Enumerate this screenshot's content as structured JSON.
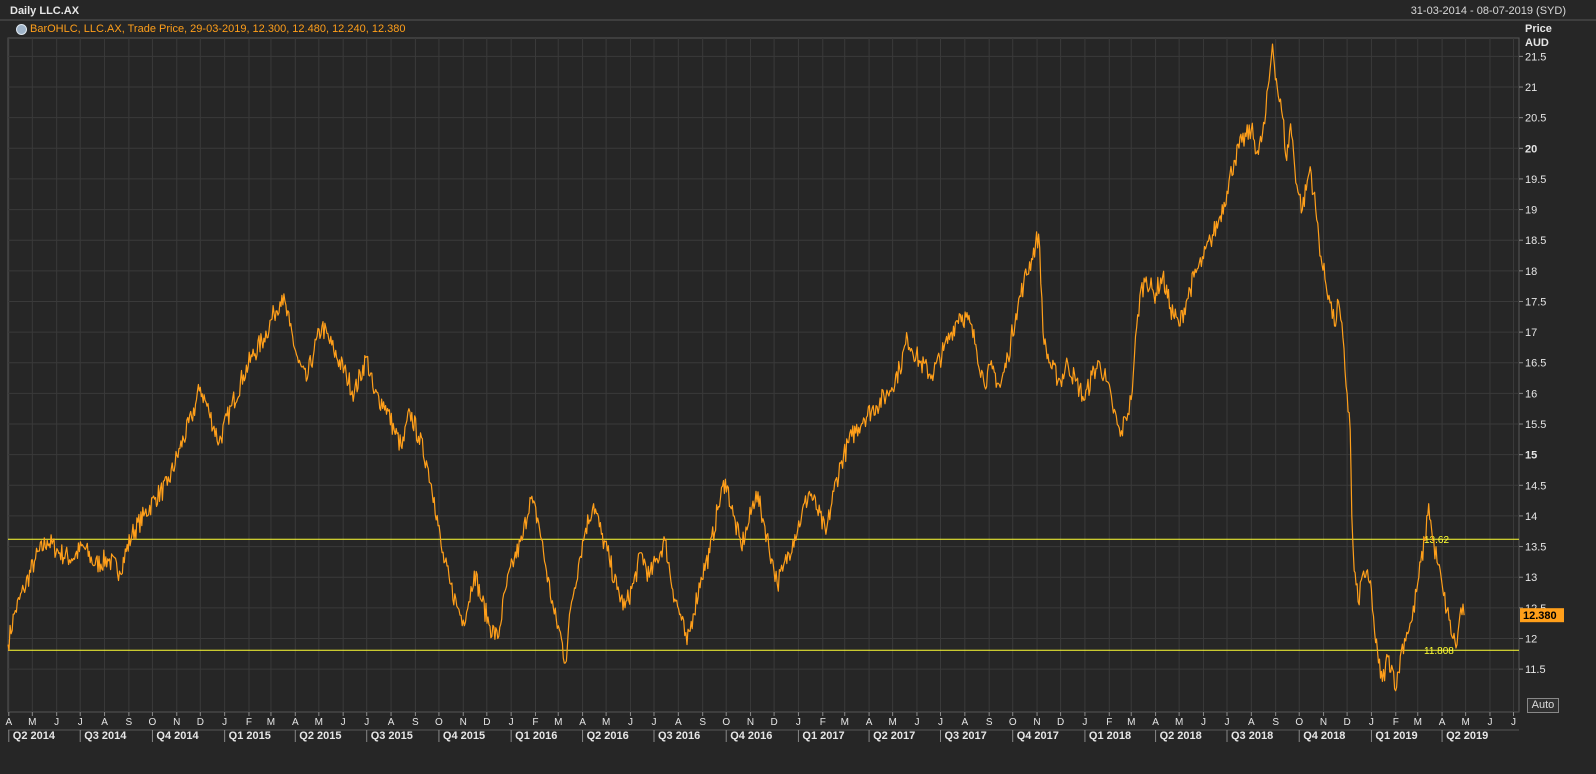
{
  "header": {
    "title": "Daily LLC.AX",
    "date_range": "31-03-2014 - 08-07-2019 (SYD)",
    "legend": "BarOHLC, LLC.AX, Trade Price, 29-03-2019, 12.300, 12.480, 12.240, 12.380",
    "y_axis_title": [
      "Price",
      "AUD"
    ],
    "auto_button": "Auto"
  },
  "colors": {
    "background": "#262626",
    "grid": "#3a3a3a",
    "price_line": "#ff9f1a",
    "level_line": "#ffff33",
    "axis_text": "#e6e6e6"
  },
  "chart_data": {
    "type": "line",
    "title": "Daily LLC.AX",
    "ylabel": "Price AUD",
    "ylim": [
      10.8,
      21.8
    ],
    "grid": true,
    "y_ticks": [
      11.5,
      12,
      12.5,
      13,
      13.5,
      14,
      14.5,
      15,
      15.5,
      16,
      16.5,
      17,
      17.5,
      18,
      18.5,
      19,
      19.5,
      20,
      20.5,
      21,
      21.5
    ],
    "bold_y_ticks": [
      15,
      20
    ],
    "month_labels": [
      "A",
      "M",
      "J",
      "J",
      "A",
      "S",
      "O",
      "N",
      "D",
      "J",
      "F",
      "M",
      "A",
      "M",
      "J",
      "J",
      "A",
      "S",
      "O",
      "N",
      "D",
      "J",
      "F",
      "M",
      "A",
      "M",
      "J",
      "J",
      "A",
      "S",
      "O",
      "N",
      "D",
      "J",
      "F",
      "M",
      "A",
      "M",
      "J",
      "J",
      "A",
      "S",
      "O",
      "N",
      "D",
      "J",
      "F",
      "M",
      "A",
      "M",
      "J",
      "J",
      "A",
      "S",
      "O",
      "N",
      "D",
      "J",
      "F",
      "M",
      "A",
      "M",
      "J",
      "J"
    ],
    "quarter_labels": [
      "Q2 2014",
      "Q3 2014",
      "Q4 2014",
      "Q1 2015",
      "Q2 2015",
      "Q3 2015",
      "Q4 2015",
      "Q1 2016",
      "Q2 2016",
      "Q3 2016",
      "Q4 2016",
      "Q1 2017",
      "Q2 2017",
      "Q3 2017",
      "Q4 2017",
      "Q1 2018",
      "Q2 2018",
      "Q3 2018",
      "Q4 2018",
      "Q1 2019",
      "Q2 2019"
    ],
    "horizontal_levels": [
      {
        "value": 13.62,
        "label": "13.62"
      },
      {
        "value": 11.808,
        "label": "11.808"
      }
    ],
    "last_price": {
      "value": 12.38,
      "label": "12.380"
    },
    "series": [
      {
        "name": "LLC.AX",
        "points": [
          [
            "2014-03-31",
            11.9
          ],
          [
            "2014-04-08",
            12.4
          ],
          [
            "2014-04-20",
            12.8
          ],
          [
            "2014-05-05",
            13.3
          ],
          [
            "2014-05-20",
            13.6
          ],
          [
            "2014-06-05",
            13.4
          ],
          [
            "2014-06-20",
            13.3
          ],
          [
            "2014-07-05",
            13.5
          ],
          [
            "2014-07-20",
            13.2
          ],
          [
            "2014-08-05",
            13.3
          ],
          [
            "2014-08-20",
            13.1
          ],
          [
            "2014-09-05",
            13.7
          ],
          [
            "2014-09-20",
            14.0
          ],
          [
            "2014-10-05",
            14.3
          ],
          [
            "2014-10-20",
            14.5
          ],
          [
            "2014-11-05",
            15.1
          ],
          [
            "2014-11-20",
            15.6
          ],
          [
            "2014-12-01",
            16.1
          ],
          [
            "2014-12-12",
            15.7
          ],
          [
            "2014-12-25",
            15.2
          ],
          [
            "2015-01-10",
            15.8
          ],
          [
            "2015-01-25",
            16.3
          ],
          [
            "2015-02-05",
            16.6
          ],
          [
            "2015-02-20",
            16.9
          ],
          [
            "2015-03-05",
            17.3
          ],
          [
            "2015-03-15",
            17.6
          ],
          [
            "2015-03-25",
            17.1
          ],
          [
            "2015-04-05",
            16.5
          ],
          [
            "2015-04-15",
            16.2
          ],
          [
            "2015-04-25",
            16.7
          ],
          [
            "2015-05-05",
            17.1
          ],
          [
            "2015-05-20",
            16.7
          ],
          [
            "2015-06-05",
            16.3
          ],
          [
            "2015-06-15",
            16.0
          ],
          [
            "2015-07-01",
            16.6
          ],
          [
            "2015-07-10",
            16.0
          ],
          [
            "2015-07-25",
            15.8
          ],
          [
            "2015-08-05",
            15.4
          ],
          [
            "2015-08-15",
            15.1
          ],
          [
            "2015-08-25",
            15.7
          ],
          [
            "2015-09-05",
            15.3
          ],
          [
            "2015-09-15",
            14.9
          ],
          [
            "2015-09-25",
            14.3
          ],
          [
            "2015-10-05",
            13.4
          ],
          [
            "2015-10-15",
            12.9
          ],
          [
            "2015-10-25",
            12.5
          ],
          [
            "2015-11-01",
            12.3
          ],
          [
            "2015-11-08",
            12.6
          ],
          [
            "2015-11-15",
            13.1
          ],
          [
            "2015-11-25",
            12.6
          ],
          [
            "2015-12-05",
            12.2
          ],
          [
            "2015-12-15",
            12.0
          ],
          [
            "2015-12-25",
            12.8
          ],
          [
            "2016-01-05",
            13.3
          ],
          [
            "2016-01-15",
            13.6
          ],
          [
            "2016-01-25",
            14.3
          ],
          [
            "2016-02-05",
            13.9
          ],
          [
            "2016-02-15",
            13.1
          ],
          [
            "2016-02-25",
            12.4
          ],
          [
            "2016-03-05",
            12.0
          ],
          [
            "2016-03-10",
            11.6
          ],
          [
            "2016-03-18",
            12.6
          ],
          [
            "2016-03-28",
            13.3
          ],
          [
            "2016-04-05",
            13.8
          ],
          [
            "2016-04-15",
            14.2
          ],
          [
            "2016-04-25",
            13.7
          ],
          [
            "2016-05-05",
            13.3
          ],
          [
            "2016-05-15",
            12.8
          ],
          [
            "2016-05-25",
            12.5
          ],
          [
            "2016-06-05",
            12.9
          ],
          [
            "2016-06-15",
            13.4
          ],
          [
            "2016-06-25",
            13.0
          ],
          [
            "2016-07-05",
            13.3
          ],
          [
            "2016-07-15",
            13.6
          ],
          [
            "2016-07-25",
            12.8
          ],
          [
            "2016-08-05",
            12.3
          ],
          [
            "2016-08-12",
            11.9
          ],
          [
            "2016-08-20",
            12.4
          ],
          [
            "2016-08-30",
            13.0
          ],
          [
            "2016-09-10",
            13.4
          ],
          [
            "2016-09-20",
            14.1
          ],
          [
            "2016-09-30",
            14.6
          ],
          [
            "2016-10-10",
            14.0
          ],
          [
            "2016-10-20",
            13.5
          ],
          [
            "2016-10-30",
            13.9
          ],
          [
            "2016-11-08",
            14.4
          ],
          [
            "2016-11-18",
            13.9
          ],
          [
            "2016-11-28",
            13.3
          ],
          [
            "2016-12-05",
            12.9
          ],
          [
            "2016-12-12",
            13.1
          ],
          [
            "2016-12-25",
            13.6
          ],
          [
            "2017-01-05",
            14.0
          ],
          [
            "2017-01-15",
            14.4
          ],
          [
            "2017-01-25",
            14.1
          ],
          [
            "2017-02-05",
            13.7
          ],
          [
            "2017-02-15",
            14.4
          ],
          [
            "2017-02-25",
            14.9
          ],
          [
            "2017-03-10",
            15.3
          ],
          [
            "2017-03-25",
            15.6
          ],
          [
            "2017-04-10",
            15.8
          ],
          [
            "2017-04-25",
            16.0
          ],
          [
            "2017-05-10",
            16.4
          ],
          [
            "2017-05-20",
            16.9
          ],
          [
            "2017-06-05",
            16.5
          ],
          [
            "2017-06-20",
            16.3
          ],
          [
            "2017-07-05",
            16.7
          ],
          [
            "2017-07-15",
            17.0
          ],
          [
            "2017-07-25",
            17.3
          ],
          [
            "2017-08-05",
            17.2
          ],
          [
            "2017-08-15",
            16.8
          ],
          [
            "2017-08-25",
            16.2
          ],
          [
            "2017-09-05",
            16.4
          ],
          [
            "2017-09-15",
            16.1
          ],
          [
            "2017-09-25",
            16.6
          ],
          [
            "2017-10-05",
            17.3
          ],
          [
            "2017-10-15",
            17.8
          ],
          [
            "2017-10-25",
            18.2
          ],
          [
            "2017-11-03",
            18.6
          ],
          [
            "2017-11-10",
            16.8
          ],
          [
            "2017-11-20",
            16.4
          ],
          [
            "2017-12-01",
            16.2
          ],
          [
            "2017-12-10",
            16.5
          ],
          [
            "2017-12-20",
            16.2
          ],
          [
            "2018-01-01",
            15.9
          ],
          [
            "2018-01-10",
            16.3
          ],
          [
            "2018-01-20",
            16.5
          ],
          [
            "2018-01-28",
            16.2
          ],
          [
            "2018-02-05",
            15.8
          ],
          [
            "2018-02-15",
            15.3
          ],
          [
            "2018-02-22",
            15.6
          ],
          [
            "2018-03-01",
            15.9
          ],
          [
            "2018-03-05",
            16.6
          ],
          [
            "2018-03-12",
            17.6
          ],
          [
            "2018-03-20",
            17.9
          ],
          [
            "2018-03-30",
            17.6
          ],
          [
            "2018-04-10",
            17.9
          ],
          [
            "2018-04-20",
            17.4
          ],
          [
            "2018-05-01",
            17.1
          ],
          [
            "2018-05-10",
            17.5
          ],
          [
            "2018-05-20",
            17.9
          ],
          [
            "2018-06-01",
            18.2
          ],
          [
            "2018-06-10",
            18.5
          ],
          [
            "2018-06-20",
            18.8
          ],
          [
            "2018-07-01",
            19.3
          ],
          [
            "2018-07-10",
            19.8
          ],
          [
            "2018-07-20",
            20.1
          ],
          [
            "2018-08-01",
            20.3
          ],
          [
            "2018-08-10",
            19.9
          ],
          [
            "2018-08-18",
            20.4
          ],
          [
            "2018-08-25",
            21.3
          ],
          [
            "2018-08-28",
            21.7
          ],
          [
            "2018-09-03",
            21.0
          ],
          [
            "2018-09-10",
            20.5
          ],
          [
            "2018-09-15",
            19.8
          ],
          [
            "2018-09-20",
            20.4
          ],
          [
            "2018-09-28",
            19.4
          ],
          [
            "2018-10-05",
            19.0
          ],
          [
            "2018-10-15",
            19.7
          ],
          [
            "2018-10-22",
            19.0
          ],
          [
            "2018-10-30",
            18.1
          ],
          [
            "2018-11-08",
            17.6
          ],
          [
            "2018-11-15",
            17.1
          ],
          [
            "2018-11-20",
            17.5
          ],
          [
            "2018-11-23",
            17.2
          ],
          [
            "2018-12-05",
            15.4
          ],
          [
            "2018-12-07",
            14.0
          ],
          [
            "2018-12-10",
            13.1
          ],
          [
            "2018-12-15",
            12.6
          ],
          [
            "2018-12-22",
            13.1
          ],
          [
            "2019-01-01",
            12.8
          ],
          [
            "2019-01-05",
            12.1
          ],
          [
            "2019-01-10",
            11.6
          ],
          [
            "2019-01-15",
            11.3
          ],
          [
            "2019-01-22",
            11.7
          ],
          [
            "2019-01-28",
            11.5
          ],
          [
            "2019-02-02",
            11.2
          ],
          [
            "2019-02-08",
            11.8
          ],
          [
            "2019-02-15",
            12.1
          ],
          [
            "2019-02-22",
            12.3
          ],
          [
            "2019-03-01",
            12.9
          ],
          [
            "2019-03-10",
            13.6
          ],
          [
            "2019-03-15",
            14.2
          ],
          [
            "2019-03-20",
            13.6
          ],
          [
            "2019-03-27",
            13.2
          ],
          [
            "2019-04-03",
            12.7
          ],
          [
            "2019-04-10",
            12.3
          ],
          [
            "2019-04-15",
            12.0
          ],
          [
            "2019-04-20",
            11.9
          ],
          [
            "2019-04-25",
            12.5
          ],
          [
            "2019-04-29",
            12.38
          ]
        ]
      }
    ]
  }
}
